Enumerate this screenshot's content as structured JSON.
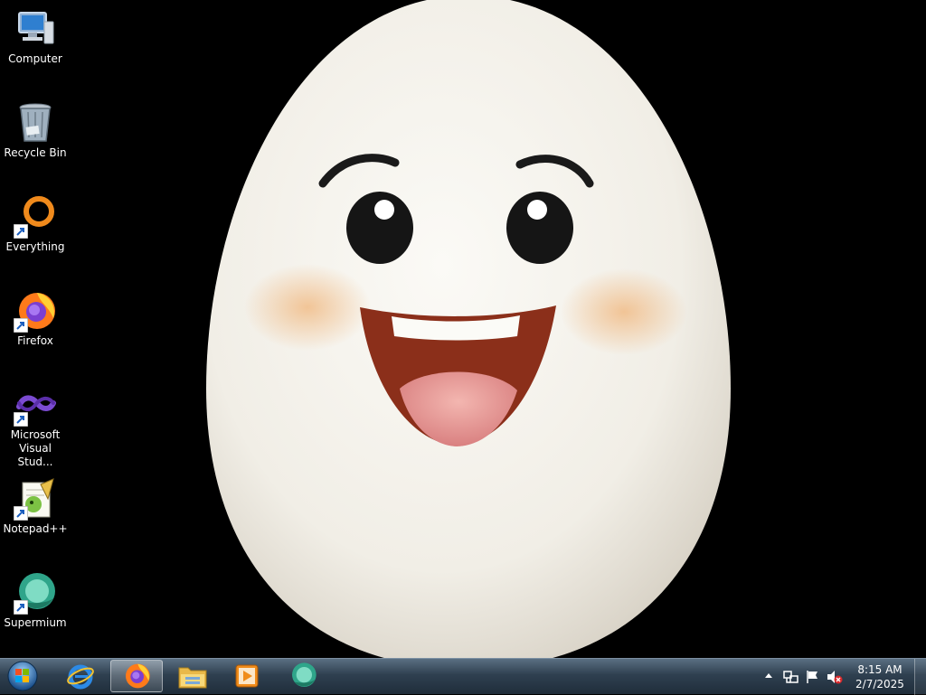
{
  "desktop": {
    "icons": [
      {
        "label": "Computer",
        "icon": "computer-icon"
      },
      {
        "label": "Recycle Bin",
        "icon": "recycle-bin-icon"
      },
      {
        "label": "Everything",
        "icon": "everything-icon"
      },
      {
        "label": "Firefox",
        "icon": "firefox-icon"
      },
      {
        "label": "Microsoft Visual Stud...",
        "icon": "visual-studio-icon"
      },
      {
        "label": "Notepad++",
        "icon": "notepad-plus-plus-icon"
      },
      {
        "label": "Supermium",
        "icon": "supermium-icon"
      }
    ],
    "wallpaper": "smiling-egg"
  },
  "taskbar": {
    "start": "start-orb-icon",
    "pinned": [
      "internet-explorer-icon",
      "firefox-icon",
      "file-explorer-icon",
      "media-player-icon",
      "supermium-icon"
    ],
    "active": "firefox-icon",
    "tray": [
      "show-hidden-icons",
      "network-icon",
      "action-center-flag-icon",
      "volume-muted-icon"
    ],
    "time": "8:15 AM",
    "date": "2/7/2025"
  },
  "colors": {
    "taskbar": "#2f4050",
    "egg": "#f4f1ea",
    "mouth": "#8b2f1a",
    "tongue": "#e8a0a0",
    "blush": "#f2c08c"
  }
}
